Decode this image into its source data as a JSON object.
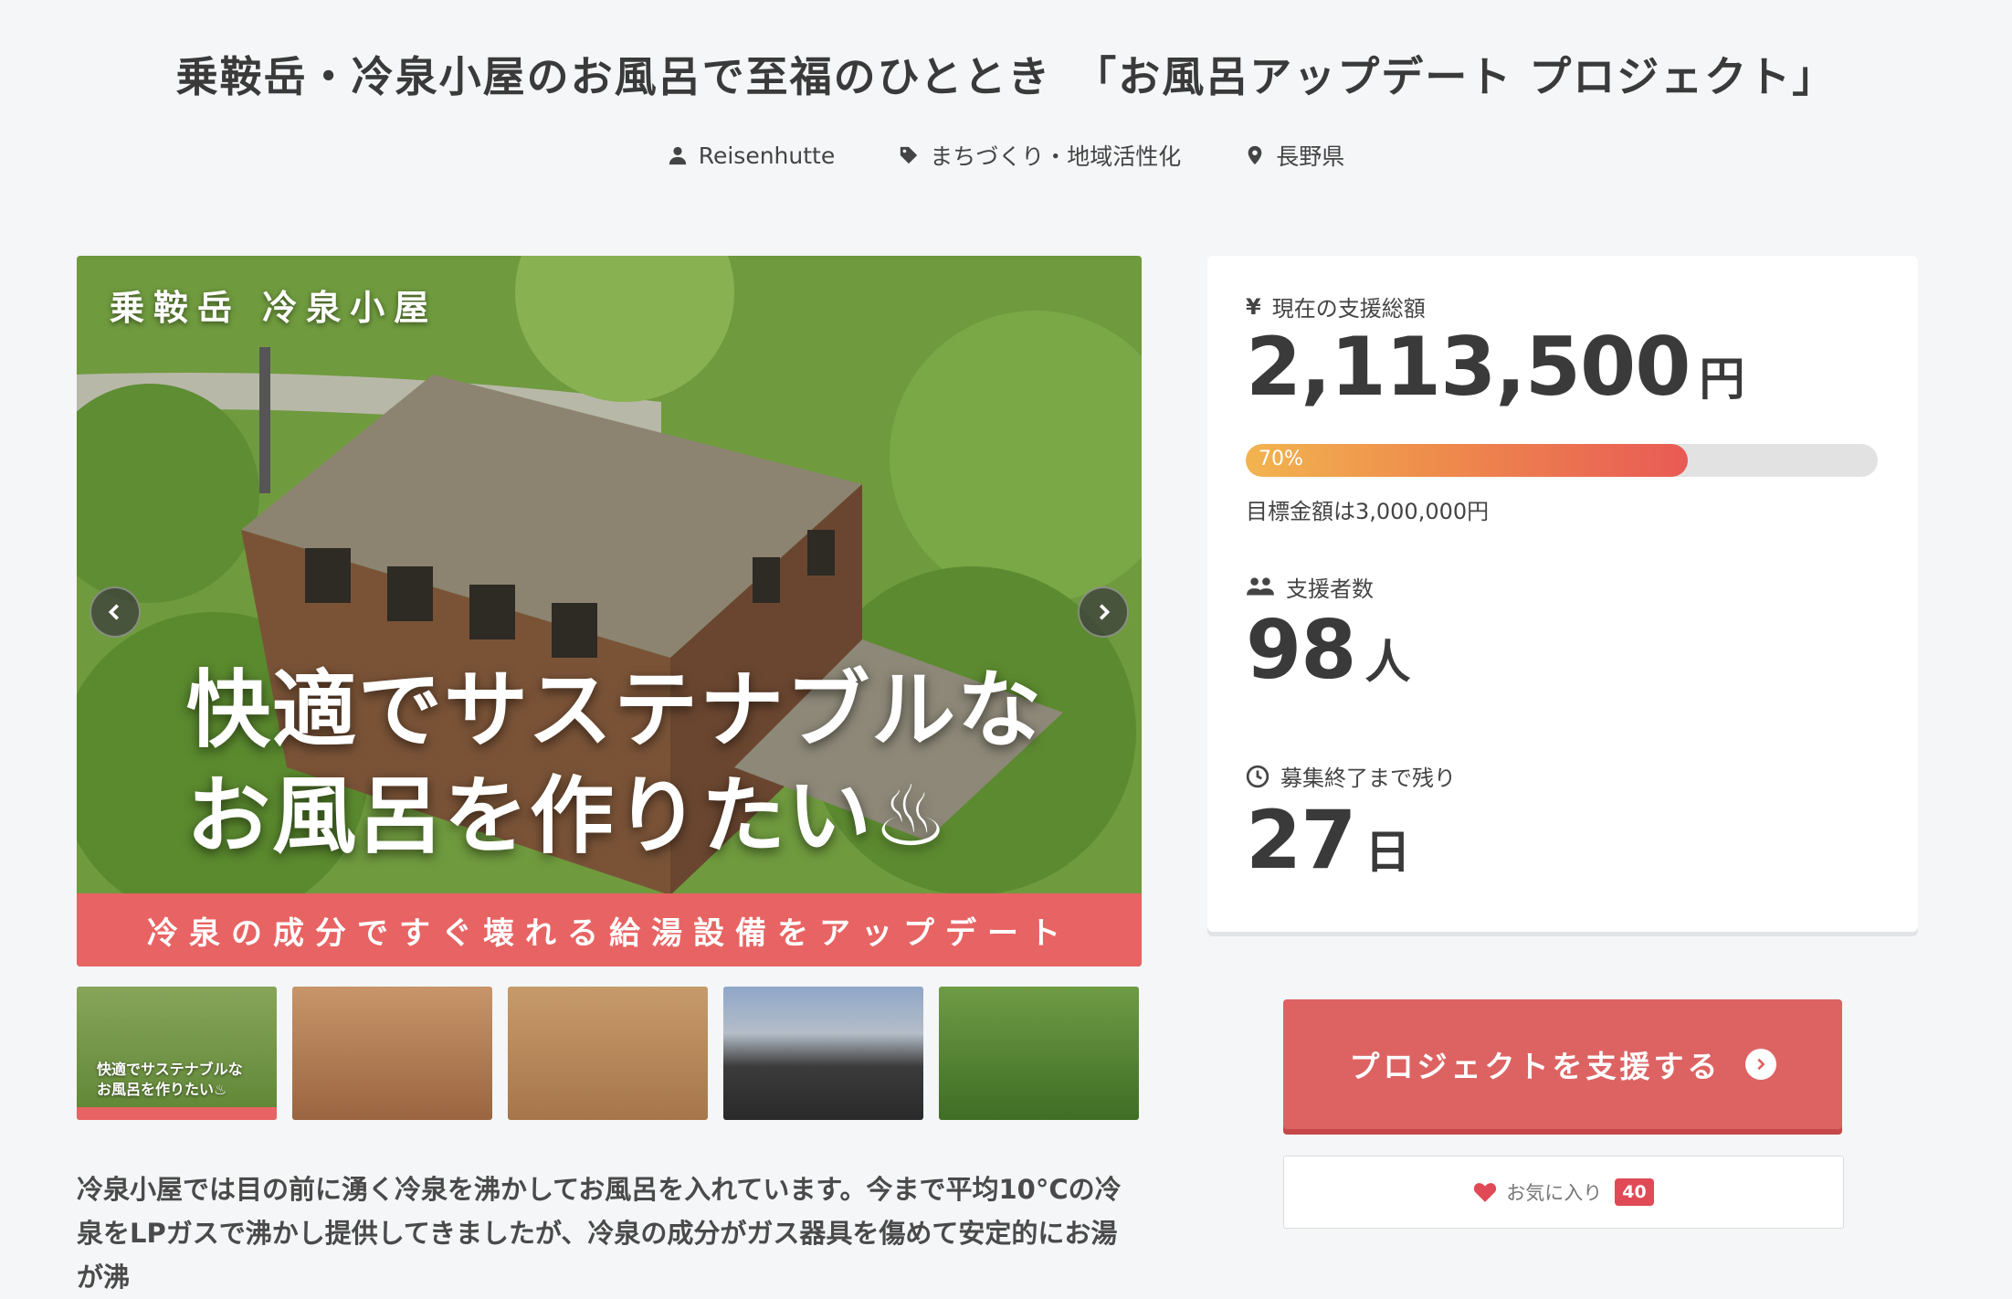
{
  "project": {
    "title": "乗鞍岳・冷泉小屋のお風呂で至福のひととき　「お風呂アップデート プロジェクト」",
    "owner": "Reisenhutte",
    "category": "まちづくり・地域活性化",
    "location": "長野県"
  },
  "hero": {
    "caption_top": "乗鞍岳 冷泉小屋",
    "headline_line1": "快適でサステナブルな",
    "headline_line2": "お風呂を作りたい♨",
    "banner": "冷泉の成分ですぐ壊れる給湯設備をアップデート"
  },
  "thumbnails": [
    {
      "caption_line1": "快適でサステナブルな",
      "caption_line2": "お風呂を作りたい♨"
    },
    {},
    {},
    {},
    {}
  ],
  "description": "冷泉小屋では目の前に湧く冷泉を沸かしてお風呂を入れています。今まで平均10°Cの冷泉をLPガスで沸かし提供してきましたが、冷泉の成分がガス器具を傷めて安定的にお湯が沸",
  "stats": {
    "amount_label": "現在の支援総額",
    "amount_value": "2,113,500",
    "amount_unit": "円",
    "progress_percent": 70,
    "progress_label": "70%",
    "goal_text": "目標金額は3,000,000円",
    "backers_label": "支援者数",
    "backers_value": "98",
    "backers_unit": "人",
    "remaining_label": "募集終了まで残り",
    "remaining_value": "27",
    "remaining_unit": "日",
    "yen_symbol": "¥"
  },
  "actions": {
    "support_label": "プロジェクトを支援する",
    "favorite_label": "お気に入り",
    "favorite_count": "40"
  },
  "colors": {
    "accent": "#dd6363",
    "banner": "#e86363",
    "favorite": "#e04a56"
  }
}
